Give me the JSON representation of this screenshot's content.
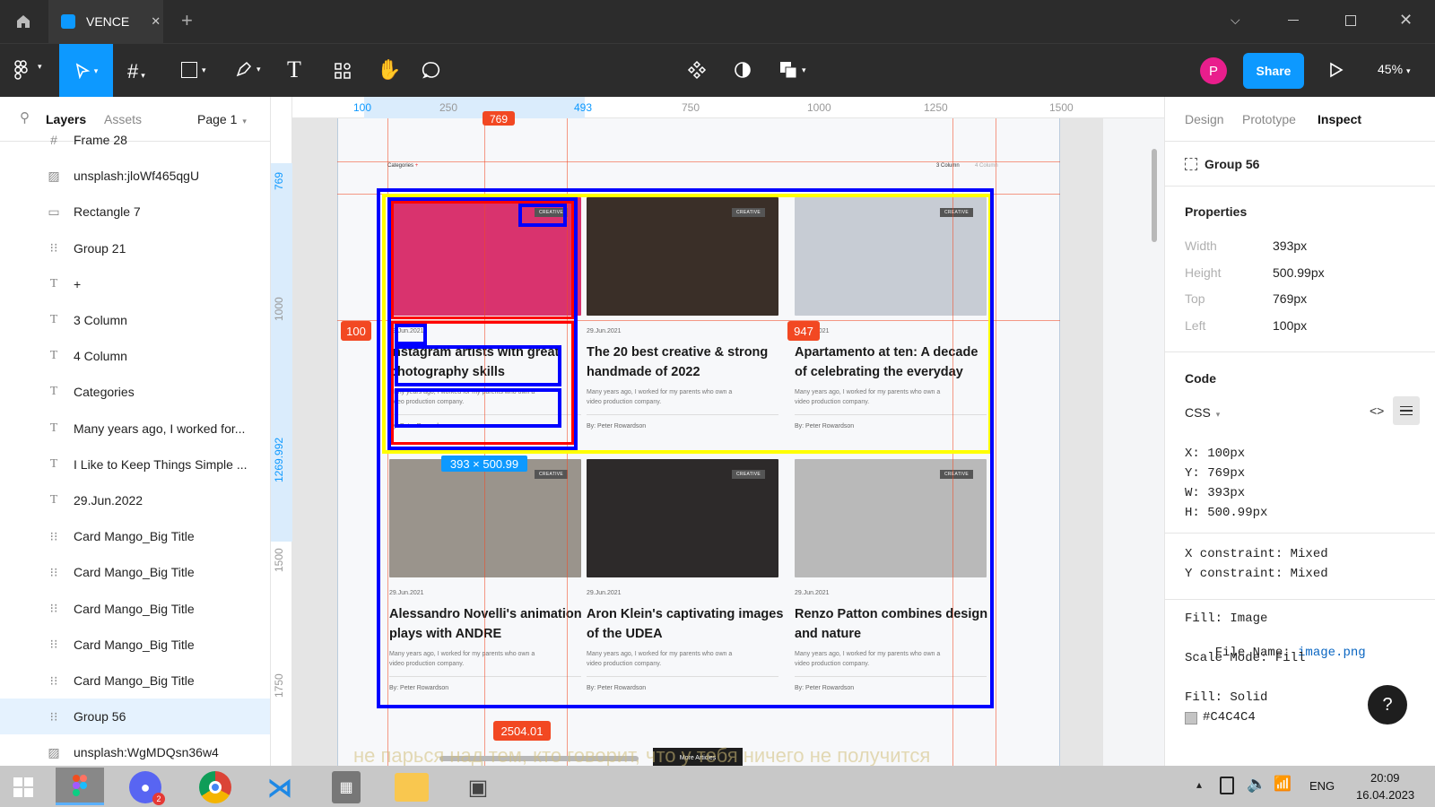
{
  "titlebar": {
    "tab_title": "VENCE",
    "tab_close": "✕",
    "new_tab": "+"
  },
  "toolbar": {
    "avatar_letter": "P",
    "share_label": "Share",
    "zoom_label": "45%"
  },
  "left_panel": {
    "tabs": {
      "layers": "Layers",
      "assets": "Assets"
    },
    "page_selector": "Page 1",
    "layers": [
      {
        "icon": "frame",
        "name": "Frame 28"
      },
      {
        "icon": "image",
        "name": "unsplash:jloWf465qgU"
      },
      {
        "icon": "rect",
        "name": "Rectangle 7"
      },
      {
        "icon": "group",
        "name": "Group 21"
      },
      {
        "icon": "text",
        "name": "+"
      },
      {
        "icon": "text",
        "name": "3 Column"
      },
      {
        "icon": "text",
        "name": "4 Column"
      },
      {
        "icon": "text",
        "name": "Categories"
      },
      {
        "icon": "text",
        "name": "Many years ago, I worked for..."
      },
      {
        "icon": "text",
        "name": "I Like to Keep Things Simple ..."
      },
      {
        "icon": "text",
        "name": "29.Jun.2022"
      },
      {
        "icon": "group",
        "name": "Card Mango_Big Title"
      },
      {
        "icon": "group",
        "name": "Card Mango_Big Title"
      },
      {
        "icon": "group",
        "name": "Card Mango_Big Title"
      },
      {
        "icon": "group",
        "name": "Card Mango_Big Title"
      },
      {
        "icon": "group",
        "name": "Card Mango_Big Title"
      },
      {
        "icon": "group",
        "name": "Group 56",
        "selected": true
      },
      {
        "icon": "image",
        "name": "unsplash:WgMDQsn36w4"
      }
    ]
  },
  "rulers": {
    "top": [
      "100",
      "250",
      "493",
      "750",
      "1000",
      "1250",
      "1500"
    ],
    "left": [
      "769",
      "1000",
      "1269.992",
      "1500",
      "1750"
    ]
  },
  "canvas": {
    "spacing_labels": {
      "left": "100",
      "right": "947",
      "top": "769",
      "bottom": "2504.01"
    },
    "size_badge": "393 × 500.99",
    "header": {
      "categories": "Categories",
      "plus": "+",
      "col3": "3 Column",
      "col4": "4 Column"
    },
    "more_button": "More Articles",
    "cards": [
      {
        "tag": "CREATIVE",
        "date": "29.Jun.2021",
        "title": "Instagram artists with great photography skills",
        "desc": "Many years ago, I worked for my parents who own a video production company.",
        "author": "By: Peter Rowardson",
        "img_color": "#d9336e"
      },
      {
        "tag": "CREATIVE",
        "date": "29.Jun.2021",
        "title": "The 20 best creative & strong handmade of 2022",
        "desc": "Many years ago, I worked for my parents who own a video production company.",
        "author": "By: Peter Rowardson",
        "img_color": "#3a2f28"
      },
      {
        "tag": "CREATIVE",
        "date": "29.Jun.2021",
        "title": "Apartamento at ten: A decade of celebrating the everyday",
        "desc": "Many years ago, I worked for my parents who own a video production company.",
        "author": "By: Peter Rowardson",
        "img_color": "#c7ccd4"
      },
      {
        "tag": "CREATIVE",
        "date": "29.Jun.2021",
        "title": "Alessandro Novelli's animation plays with ANDRE",
        "desc": "Many years ago, I worked for my parents who own a video production company.",
        "author": "By: Peter Rowardson",
        "img_color": "#9a948c"
      },
      {
        "tag": "CREATIVE",
        "date": "29.Jun.2021",
        "title": "Aron Klein's captivating images of the UDEA",
        "desc": "Many years ago, I worked for my parents who own a video production company.",
        "author": "By: Peter Rowardson",
        "img_color": "#2d2a2a"
      },
      {
        "tag": "CREATIVE",
        "date": "29.Jun.2021",
        "title": "Renzo Patton combines design and nature",
        "desc": "Many years ago, I worked for my parents who own a video production company.",
        "author": "By: Peter Rowardson",
        "img_color": "#b9b9b9"
      }
    ],
    "overlay_caption": "не парься над тем, кто говорит, что у тебя ничего не получится"
  },
  "right_panel": {
    "tabs": {
      "design": "Design",
      "prototype": "Prototype",
      "inspect": "Inspect"
    },
    "selection_name": "Group 56",
    "properties_title": "Properties",
    "properties": [
      {
        "key": "Width",
        "value": "393px"
      },
      {
        "key": "Height",
        "value": "500.99px"
      },
      {
        "key": "Top",
        "value": "769px"
      },
      {
        "key": "Left",
        "value": "100px"
      }
    ],
    "code_title": "Code",
    "code_lang": "CSS",
    "code_lines": [
      "X: 100px",
      "Y: 769px",
      "W: 393px",
      "H: 500.99px"
    ],
    "constraints": [
      "X constraint: Mixed",
      "Y constraint: Mixed"
    ],
    "fill_image": {
      "fill": "Fill: Image",
      "file_label": "File Name: ",
      "file_name": "image.png",
      "scale": "Scale Mode: Fill"
    },
    "fill_solid": {
      "fill": "Fill: Solid",
      "color": "#C4C4C4"
    },
    "help": "?"
  },
  "taskbar": {
    "discord_badge": "2",
    "lang": "ENG",
    "time": "20:09",
    "date": "16.04.2023"
  },
  "colors": {
    "accent": "#0d99ff",
    "selection_blue": "#0000ff",
    "guide_red": "#f24822",
    "avatar": "#e91e8c",
    "yellow": "#ffff00"
  }
}
